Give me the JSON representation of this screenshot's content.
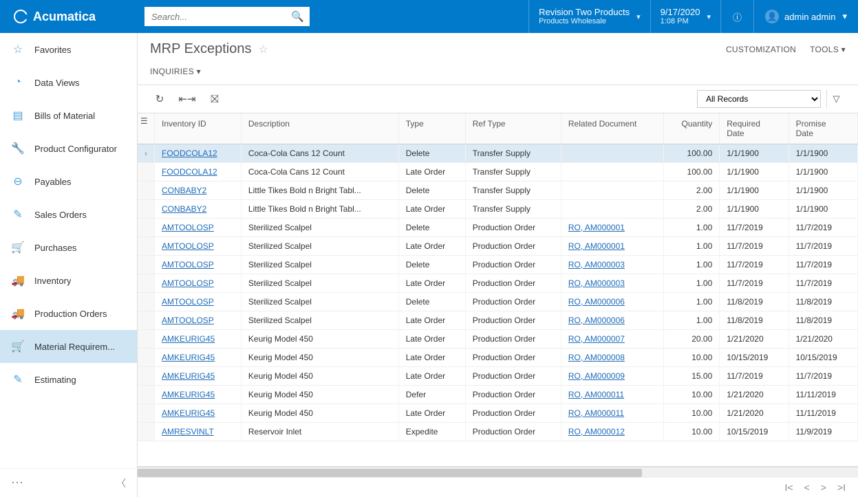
{
  "brand": "Acumatica",
  "search": {
    "placeholder": "Search..."
  },
  "tenant": {
    "name": "Revision Two Products",
    "sub": "Products Wholesale"
  },
  "datetime": {
    "date": "9/17/2020",
    "time": "1:08 PM"
  },
  "user": {
    "name": "admin admin"
  },
  "sidebar": {
    "items": [
      {
        "label": "Favorites",
        "icon": "star"
      },
      {
        "label": "Data Views",
        "icon": "pie"
      },
      {
        "label": "Bills of Material",
        "icon": "list"
      },
      {
        "label": "Product Configurator",
        "icon": "wrench"
      },
      {
        "label": "Payables",
        "icon": "minus-circle"
      },
      {
        "label": "Sales Orders",
        "icon": "edit"
      },
      {
        "label": "Purchases",
        "icon": "cart"
      },
      {
        "label": "Inventory",
        "icon": "truck"
      },
      {
        "label": "Production Orders",
        "icon": "truck"
      },
      {
        "label": "Material Requirem...",
        "icon": "cart-plus",
        "active": true
      },
      {
        "label": "Estimating",
        "icon": "pencil"
      }
    ]
  },
  "page": {
    "title": "MRP Exceptions",
    "inquiries": "INQUIRIES",
    "customization": "CUSTOMIZATION",
    "tools": "TOOLS"
  },
  "filter": {
    "selected": "All Records"
  },
  "columns": {
    "inventory_id": "Inventory ID",
    "description": "Description",
    "type": "Type",
    "ref_type": "Ref Type",
    "related_document": "Related Document",
    "quantity": "Quantity",
    "required_date": "Required\nDate",
    "promise_date": "Promise\nDate"
  },
  "rows": [
    {
      "inv": "FOODCOLA12",
      "desc": "Coca-Cola Cans 12 Count",
      "type": "Delete",
      "ref": "Transfer Supply",
      "doc": "",
      "qty": "100.00",
      "req": "1/1/1900",
      "prom": "1/1/1900",
      "selected": true
    },
    {
      "inv": "FOODCOLA12",
      "desc": "Coca-Cola Cans 12 Count",
      "type": "Late Order",
      "ref": "Transfer Supply",
      "doc": "",
      "qty": "100.00",
      "req": "1/1/1900",
      "prom": "1/1/1900"
    },
    {
      "inv": "CONBABY2",
      "desc": "Little Tikes Bold n Bright Tabl...",
      "type": "Delete",
      "ref": "Transfer Supply",
      "doc": "",
      "qty": "2.00",
      "req": "1/1/1900",
      "prom": "1/1/1900"
    },
    {
      "inv": "CONBABY2",
      "desc": "Little Tikes Bold n Bright Tabl...",
      "type": "Late Order",
      "ref": "Transfer Supply",
      "doc": "",
      "qty": "2.00",
      "req": "1/1/1900",
      "prom": "1/1/1900"
    },
    {
      "inv": "AMTOOLOSP",
      "desc": "Sterilized Scalpel",
      "type": "Delete",
      "ref": "Production Order",
      "doc": "RO, AM000001",
      "qty": "1.00",
      "req": "11/7/2019",
      "prom": "11/7/2019"
    },
    {
      "inv": "AMTOOLOSP",
      "desc": "Sterilized Scalpel",
      "type": "Late Order",
      "ref": "Production Order",
      "doc": "RO, AM000001",
      "qty": "1.00",
      "req": "11/7/2019",
      "prom": "11/7/2019"
    },
    {
      "inv": "AMTOOLOSP",
      "desc": "Sterilized Scalpel",
      "type": "Delete",
      "ref": "Production Order",
      "doc": "RO, AM000003",
      "qty": "1.00",
      "req": "11/7/2019",
      "prom": "11/7/2019"
    },
    {
      "inv": "AMTOOLOSP",
      "desc": "Sterilized Scalpel",
      "type": "Late Order",
      "ref": "Production Order",
      "doc": "RO, AM000003",
      "qty": "1.00",
      "req": "11/7/2019",
      "prom": "11/7/2019"
    },
    {
      "inv": "AMTOOLOSP",
      "desc": "Sterilized Scalpel",
      "type": "Delete",
      "ref": "Production Order",
      "doc": "RO, AM000006",
      "qty": "1.00",
      "req": "11/8/2019",
      "prom": "11/8/2019"
    },
    {
      "inv": "AMTOOLOSP",
      "desc": "Sterilized Scalpel",
      "type": "Late Order",
      "ref": "Production Order",
      "doc": "RO, AM000006",
      "qty": "1.00",
      "req": "11/8/2019",
      "prom": "11/8/2019"
    },
    {
      "inv": "AMKEURIG45",
      "desc": "Keurig Model 450",
      "type": "Late Order",
      "ref": "Production Order",
      "doc": "RO, AM000007",
      "qty": "20.00",
      "req": "1/21/2020",
      "prom": "1/21/2020"
    },
    {
      "inv": "AMKEURIG45",
      "desc": "Keurig Model 450",
      "type": "Late Order",
      "ref": "Production Order",
      "doc": "RO, AM000008",
      "qty": "10.00",
      "req": "10/15/2019",
      "prom": "10/15/2019"
    },
    {
      "inv": "AMKEURIG45",
      "desc": "Keurig Model 450",
      "type": "Late Order",
      "ref": "Production Order",
      "doc": "RO, AM000009",
      "qty": "15.00",
      "req": "11/7/2019",
      "prom": "11/7/2019"
    },
    {
      "inv": "AMKEURIG45",
      "desc": "Keurig Model 450",
      "type": "Defer",
      "ref": "Production Order",
      "doc": "RO, AM000011",
      "qty": "10.00",
      "req": "1/21/2020",
      "prom": "11/11/2019"
    },
    {
      "inv": "AMKEURIG45",
      "desc": "Keurig Model 450",
      "type": "Late Order",
      "ref": "Production Order",
      "doc": "RO, AM000011",
      "qty": "10.00",
      "req": "1/21/2020",
      "prom": "11/11/2019"
    },
    {
      "inv": "AMRESVINLT",
      "desc": "Reservoir Inlet",
      "type": "Expedite",
      "ref": "Production Order",
      "doc": "RO, AM000012",
      "qty": "10.00",
      "req": "10/15/2019",
      "prom": "11/9/2019"
    }
  ],
  "icons": {
    "star": "☆",
    "pie": "◔",
    "list": "▤",
    "wrench": "🔧",
    "minus-circle": "⊖",
    "edit": "✎",
    "cart": "🛒",
    "truck": "🚚",
    "cart-plus": "🛒",
    "pencil": "✎"
  }
}
